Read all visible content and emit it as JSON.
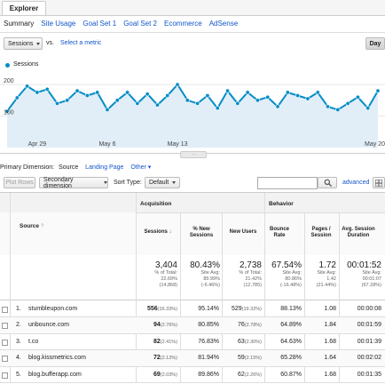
{
  "window": {
    "tab_label": "Explorer"
  },
  "subtabs": [
    "Summary",
    "Site Usage",
    "Goal Set 1",
    "Goal Set 2",
    "Ecommerce",
    "AdSense"
  ],
  "metric_bar": {
    "metric": "Sessions",
    "vs": "vs.",
    "select_metric": "Select a metric",
    "day_button": "Day"
  },
  "legend": {
    "series_name": "Sessions",
    "color": "#058dc7"
  },
  "chart_data": {
    "type": "area",
    "series": [
      {
        "name": "Sessions",
        "values": [
          115,
          158,
          195,
          175,
          185,
          140,
          150,
          180,
          165,
          175,
          120,
          150,
          175,
          140,
          170,
          135,
          165,
          200,
          150,
          140,
          165,
          125,
          180,
          140,
          175,
          150,
          160,
          130,
          175,
          165,
          155,
          175,
          130,
          120,
          140,
          160,
          125,
          180
        ]
      }
    ],
    "y_ticks": [
      100,
      200
    ],
    "x_tick_labels": [
      "Apr 29",
      "May 6",
      "May 13",
      "May 20"
    ],
    "grid": true
  },
  "primary_dimension": {
    "label": "Primary Dimension:",
    "active": "Source",
    "options": [
      "Landing Page",
      "Other"
    ]
  },
  "toolbar": {
    "plot_rows": "Plot Rows",
    "secondary_dimension": "Secondary dimension",
    "sort_type_label": "Sort Type:",
    "sort_type_value": "Default",
    "advanced": "advanced"
  },
  "table": {
    "groups": {
      "acquisition": "Acquisition",
      "behavior": "Behavior"
    },
    "headers": {
      "source": "Source",
      "sessions": "Sessions",
      "new_sessions": "% New Sessions",
      "new_users": "New Users",
      "bounce": "Bounce Rate",
      "pages": "Pages / Session",
      "duration": "Avg. Session Duration"
    },
    "totals": {
      "sessions": {
        "big": "3,404",
        "l1": "% of Total:",
        "l2": "22.69%",
        "l3": "(14,868)"
      },
      "new_sessions": {
        "big": "80.43%",
        "l1": "Site Avg:",
        "l2": "85.99%",
        "l3": "(-6.46%)"
      },
      "new_users": {
        "big": "2,738",
        "l1": "% of Total:",
        "l2": "21.42%",
        "l3": "(12,785)"
      },
      "bounce": {
        "big": "67.54%",
        "l1": "Site Avg:",
        "l2": "80.86%",
        "l3": "(-16.48%)"
      },
      "pages": {
        "big": "1.72",
        "l1": "Site Avg:",
        "l2": "1.42",
        "l3": "(21.44%)"
      },
      "duration": {
        "big": "00:01:52",
        "l1": "Site Avg:",
        "l2": "00:01:07",
        "l3": "(67.28%)"
      }
    },
    "rows": [
      {
        "num": "1.",
        "source": "stumbleupon.com",
        "sessions": "556",
        "sessions_pct": "(16.33%)",
        "new_sessions": "95.14%",
        "new_users": "529",
        "new_users_pct": "(19.32%)",
        "bounce": "88.13%",
        "pages": "1.08",
        "duration": "00:00:08"
      },
      {
        "num": "2.",
        "source": "unbounce.com",
        "sessions": "94",
        "sessions_pct": "(2.76%)",
        "new_sessions": "80.85%",
        "new_users": "76",
        "new_users_pct": "(2.78%)",
        "bounce": "64.89%",
        "pages": "1.84",
        "duration": "00:01:59"
      },
      {
        "num": "3.",
        "source": "t.co",
        "sessions": "82",
        "sessions_pct": "(2.41%)",
        "new_sessions": "76.83%",
        "new_users": "63",
        "new_users_pct": "(2.30%)",
        "bounce": "64.63%",
        "pages": "1.68",
        "duration": "00:01:39"
      },
      {
        "num": "4.",
        "source": "blog.kissmetrics.com",
        "sessions": "72",
        "sessions_pct": "(2.12%)",
        "new_sessions": "81.94%",
        "new_users": "59",
        "new_users_pct": "(2.15%)",
        "bounce": "65.28%",
        "pages": "1.64",
        "duration": "00:02:02"
      },
      {
        "num": "5.",
        "source": "blog.bufferapp.com",
        "sessions": "69",
        "sessions_pct": "(2.03%)",
        "new_sessions": "89.86%",
        "new_users": "62",
        "new_users_pct": "(2.26%)",
        "bounce": "60.87%",
        "pages": "1.68",
        "duration": "00:01:35"
      }
    ]
  }
}
